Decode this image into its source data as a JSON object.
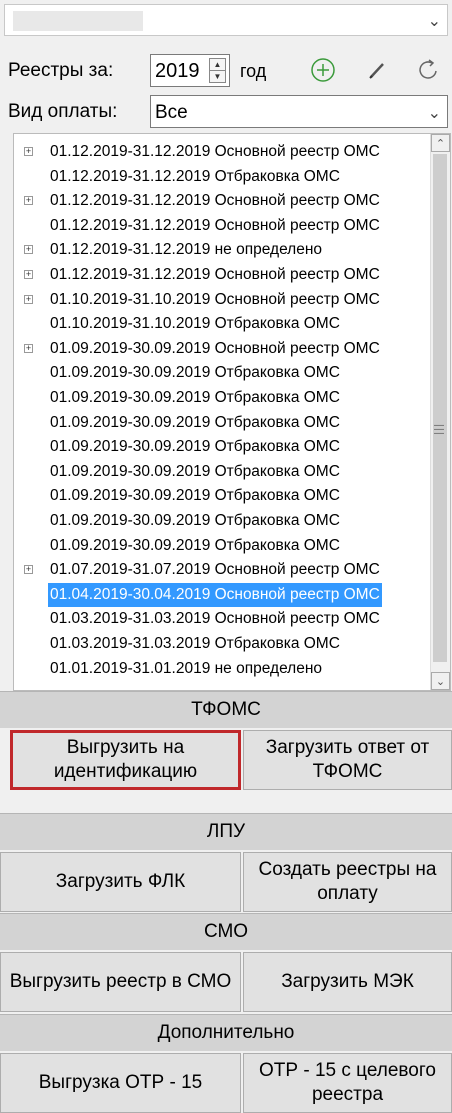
{
  "header": {
    "registries_label": "Реестры за:",
    "year_value": "2019",
    "year_unit_label": "год",
    "payment_label": "Вид оплаты:",
    "payment_value": "Все"
  },
  "icons": {
    "add": "plus-circle-icon",
    "edit": "pencil-icon",
    "refresh": "refresh-icon",
    "chevron": "chevron-down-icon"
  },
  "list": {
    "items": [
      {
        "text": "01.12.2019-31.12.2019 Основной реестр ОМС",
        "expandable": true,
        "selected": false
      },
      {
        "text": "01.12.2019-31.12.2019 Отбраковка ОМС",
        "expandable": false,
        "selected": false
      },
      {
        "text": "01.12.2019-31.12.2019 Основной реестр ОМС",
        "expandable": true,
        "selected": false
      },
      {
        "text": "01.12.2019-31.12.2019 Основной реестр ОМС",
        "expandable": false,
        "selected": false
      },
      {
        "text": "01.12.2019-31.12.2019  не определено",
        "expandable": true,
        "selected": false
      },
      {
        "text": "01.12.2019-31.12.2019 Основной реестр ОМС",
        "expandable": true,
        "selected": false
      },
      {
        "text": "01.10.2019-31.10.2019 Основной реестр ОМС",
        "expandable": true,
        "selected": false
      },
      {
        "text": "01.10.2019-31.10.2019 Отбраковка ОМС",
        "expandable": false,
        "selected": false
      },
      {
        "text": "01.09.2019-30.09.2019 Основной реестр ОМС",
        "expandable": true,
        "selected": false
      },
      {
        "text": "01.09.2019-30.09.2019 Отбраковка ОМС",
        "expandable": false,
        "selected": false
      },
      {
        "text": "01.09.2019-30.09.2019 Отбраковка ОМС",
        "expandable": false,
        "selected": false
      },
      {
        "text": "01.09.2019-30.09.2019 Отбраковка ОМС",
        "expandable": false,
        "selected": false
      },
      {
        "text": "01.09.2019-30.09.2019 Отбраковка ОМС",
        "expandable": false,
        "selected": false
      },
      {
        "text": "01.09.2019-30.09.2019 Отбраковка ОМС",
        "expandable": false,
        "selected": false
      },
      {
        "text": "01.09.2019-30.09.2019 Отбраковка ОМС",
        "expandable": false,
        "selected": false
      },
      {
        "text": "01.09.2019-30.09.2019 Отбраковка ОМС",
        "expandable": false,
        "selected": false
      },
      {
        "text": "01.09.2019-30.09.2019 Отбраковка ОМС",
        "expandable": false,
        "selected": false
      },
      {
        "text": "01.07.2019-31.07.2019 Основной реестр ОМС",
        "expandable": true,
        "selected": false
      },
      {
        "text": "01.04.2019-30.04.2019 Основной реестр ОМС",
        "expandable": false,
        "selected": true
      },
      {
        "text": "01.03.2019-31.03.2019 Основной реестр ОМС",
        "expandable": false,
        "selected": false
      },
      {
        "text": "01.03.2019-31.03.2019 Отбраковка ОМС",
        "expandable": false,
        "selected": false
      },
      {
        "text": "01.01.2019-31.01.2019  не определено",
        "expandable": false,
        "selected": false
      }
    ]
  },
  "sections": {
    "tfoms": "ТФОМС",
    "lpu": "ЛПУ",
    "smo": "СМО",
    "extra": "Дополнительно"
  },
  "buttons": {
    "export_identification": "Выгрузить на идентификацию",
    "load_tfoms_response": "Загрузить ответ от ТФОМС",
    "load_flk": "Загрузить ФЛК",
    "create_payment_registries": "Создать реестры на оплату",
    "export_registry_smo": "Выгрузить реестр в СМО",
    "load_mek": "Загрузить МЭК",
    "export_otr15": "Выгрузка ОТР - 15",
    "otr15_target": "ОТР - 15 с целевого реестра"
  },
  "colors": {
    "selection": "#3399ff",
    "focus_border": "#c0282b",
    "add_icon": "#3a9a3a"
  }
}
